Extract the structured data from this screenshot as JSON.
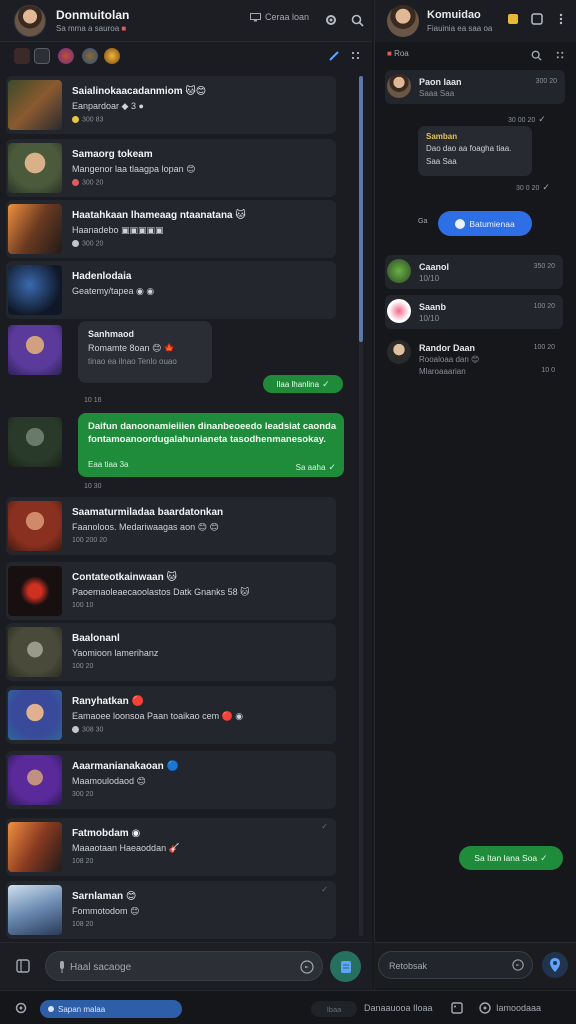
{
  "left": {
    "header": {
      "title": "Donmuitolan",
      "subtitle": "Sa mma a sauroa",
      "subtitle_warn": "■",
      "status": "Ceraa  loan"
    },
    "items": [
      {
        "name": "Saialinokaacadanmiom 🐱😊",
        "preview": "Eanpardoar  ◆ 3 ●",
        "meta": "300 83"
      },
      {
        "name": "Samaorg tokeam",
        "preview": "Mangenor laa tlaagpa lopan 😊",
        "meta": "300 20"
      },
      {
        "name": "Haatahkaan lhameaag ntaanatana 🐱",
        "preview": "Haanadebo ▣▣▣▣▣",
        "meta": "300 20"
      },
      {
        "name": "Hadenlodaia",
        "preview": "Geatemy/tapea ◉ ◉",
        "meta": ""
      },
      {
        "name": "Saamaturmiladaa baardatonkan",
        "preview": "Faanoloos. Medariwaagas aon 😊 😊",
        "meta": "100 200 20"
      },
      {
        "name": "Contateotkainwaan 🐱",
        "preview": "Paoemaoleaecaoolastos Datk Gnanks 58 🐱",
        "meta": "100 10"
      },
      {
        "name": "Baalonanl",
        "preview": "Yaomioon lamerihanz",
        "meta": "100 20"
      },
      {
        "name": "Ranyhatkan 🔴",
        "preview": "Eamaoee loonsoa Paan toaikao cem 🔴 ◉",
        "meta": "308 30"
      },
      {
        "name": "Aaarmanianakaoan 🔵",
        "preview": "Maamoulodaod 😊",
        "meta": "300 20"
      },
      {
        "name": "Fatmobdam ◉",
        "preview": "Maaaotaan Haeaoddan 🎸",
        "meta": "108 20"
      },
      {
        "name": "Sarnlaman 😊",
        "preview": "Fommotodom 😊",
        "meta": "108 20"
      }
    ],
    "bubble": {
      "title": "Sanhmaod",
      "line": "Romamte 8oan 😊 🍁",
      "time": "tinao ea ilnao Tenlo ouao"
    },
    "green_pill": "Ilaa lhanlina",
    "small_time_1": "10 16",
    "big_green": {
      "text": "Daifun danoonamieiiien dinanbeoeedo leadsiat caonda fontamoanoordugalahunianeta tasodhenmanesokay.",
      "footer": "Eaa tiaa 3a",
      "footer_time": "Sa aaha"
    },
    "small_time_2": "10 30",
    "composer_placeholder": "Haal sacaoge"
  },
  "right": {
    "header": {
      "title": "Komuidao",
      "subtitle": "Fiauinia ea saa oa"
    },
    "toolbar_label": "Roa",
    "cards": [
      {
        "name": "Paon Iaan",
        "sub": "Saaa Saa",
        "time": "300 20"
      },
      {
        "name": "Caanol",
        "sub": "10/10",
        "time": "350 20"
      },
      {
        "name": "Saanb",
        "sub": "10/10",
        "time": "100 20"
      },
      {
        "name": "Randor Daan",
        "sub": "Rooaloaa dan 😊",
        "time": "100 20"
      }
    ],
    "small_time_a": "30 00 20",
    "bubble": {
      "title": "Samban",
      "line1": "Dao dao aa foagha tiaa.",
      "line2": "Saa Saa"
    },
    "small_time_b": "30 0 20",
    "left_label": "Ga",
    "blue_pill": "Batumienaa",
    "card4_extra": "Mlaroaaarian",
    "card4_extra_time": "10 0",
    "green_pill": "Sa Itan lana Soa",
    "composer_placeholder": "Retobsak"
  },
  "bottom": {
    "pill": "Sapan malaa",
    "ghost": "Ibaa",
    "text1": "Danaauooa Iloaa",
    "text2": "Iamoodaaa"
  },
  "colors": {
    "accent_green": "#1f8c3c",
    "accent_blue": "#2f6fe6",
    "panel": "#23262c",
    "background": "#17191d"
  },
  "icons": [
    "search-icon",
    "gear-icon",
    "more-icon",
    "attach-icon",
    "mic-icon",
    "emoji-icon",
    "send-icon",
    "pencil-icon",
    "grid-icon",
    "check-icon"
  ]
}
